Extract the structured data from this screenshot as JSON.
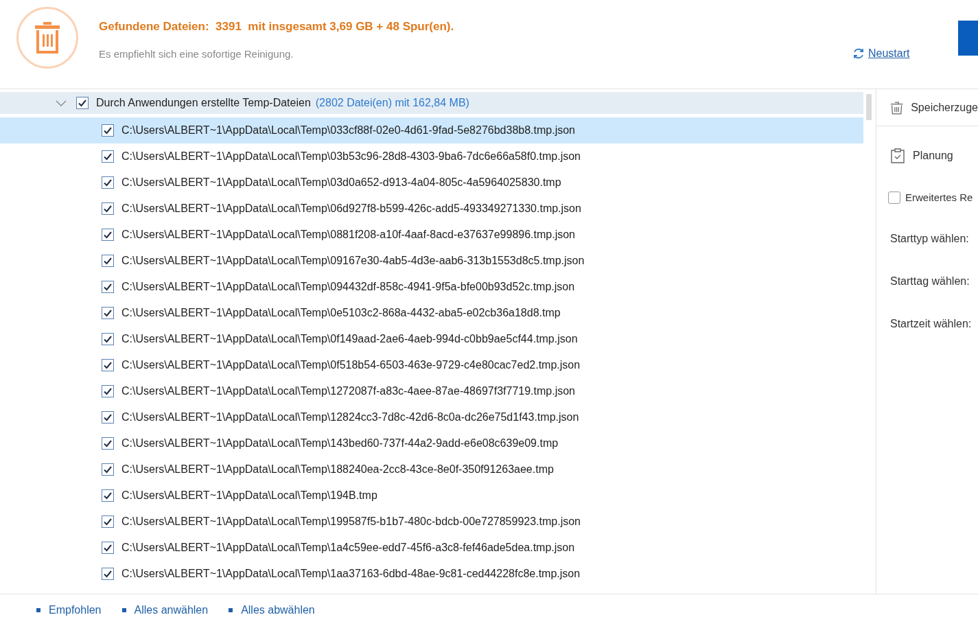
{
  "header": {
    "title": "Gefundene Dateien:  3391  mit insgesamt 3,69 GB + 48 Spur(en).",
    "subtitle": "Es empfiehlt sich eine sofortige Reinigung.",
    "restart_link": "Neustart"
  },
  "group": {
    "label": "Durch Anwendungen erstellte Temp-Dateien",
    "info": "(2802 Datei(en) mit 162,84 MB)",
    "expanded": true,
    "checked": true,
    "files": [
      {
        "path": "C:\\Users\\ALBERT~1\\AppData\\Local\\Temp\\033cf88f-02e0-4d61-9fad-5e8276bd38b8.tmp.json",
        "checked": true,
        "selected": true
      },
      {
        "path": "C:\\Users\\ALBERT~1\\AppData\\Local\\Temp\\03b53c96-28d8-4303-9ba6-7dc6e66a58f0.tmp.json",
        "checked": true,
        "selected": false
      },
      {
        "path": "C:\\Users\\ALBERT~1\\AppData\\Local\\Temp\\03d0a652-d913-4a04-805c-4a5964025830.tmp",
        "checked": true,
        "selected": false
      },
      {
        "path": "C:\\Users\\ALBERT~1\\AppData\\Local\\Temp\\06d927f8-b599-426c-add5-493349271330.tmp.json",
        "checked": true,
        "selected": false
      },
      {
        "path": "C:\\Users\\ALBERT~1\\AppData\\Local\\Temp\\0881f208-a10f-4aaf-8acd-e37637e99896.tmp.json",
        "checked": true,
        "selected": false
      },
      {
        "path": "C:\\Users\\ALBERT~1\\AppData\\Local\\Temp\\09167e30-4ab5-4d3e-aab6-313b1553d8c5.tmp.json",
        "checked": true,
        "selected": false
      },
      {
        "path": "C:\\Users\\ALBERT~1\\AppData\\Local\\Temp\\094432df-858c-4941-9f5a-bfe00b93d52c.tmp.json",
        "checked": true,
        "selected": false
      },
      {
        "path": "C:\\Users\\ALBERT~1\\AppData\\Local\\Temp\\0e5103c2-868a-4432-aba5-e02cb36a18d8.tmp",
        "checked": true,
        "selected": false
      },
      {
        "path": "C:\\Users\\ALBERT~1\\AppData\\Local\\Temp\\0f149aad-2ae6-4aeb-994d-c0bb9ae5cf44.tmp.json",
        "checked": true,
        "selected": false
      },
      {
        "path": "C:\\Users\\ALBERT~1\\AppData\\Local\\Temp\\0f518b54-6503-463e-9729-c4e80cac7ed2.tmp.json",
        "checked": true,
        "selected": false
      },
      {
        "path": "C:\\Users\\ALBERT~1\\AppData\\Local\\Temp\\1272087f-a83c-4aee-87ae-48697f3f7719.tmp.json",
        "checked": true,
        "selected": false
      },
      {
        "path": "C:\\Users\\ALBERT~1\\AppData\\Local\\Temp\\12824cc3-7d8c-42d6-8c0a-dc26e75d1f43.tmp.json",
        "checked": true,
        "selected": false
      },
      {
        "path": "C:\\Users\\ALBERT~1\\AppData\\Local\\Temp\\143bed60-737f-44a2-9add-e6e08c639e09.tmp",
        "checked": true,
        "selected": false
      },
      {
        "path": "C:\\Users\\ALBERT~1\\AppData\\Local\\Temp\\188240ea-2cc8-43ce-8e0f-350f91263aee.tmp",
        "checked": true,
        "selected": false
      },
      {
        "path": "C:\\Users\\ALBERT~1\\AppData\\Local\\Temp\\194B.tmp",
        "checked": true,
        "selected": false
      },
      {
        "path": "C:\\Users\\ALBERT~1\\AppData\\Local\\Temp\\199587f5-b1b7-480c-bdcb-00e727859923.tmp.json",
        "checked": true,
        "selected": false
      },
      {
        "path": "C:\\Users\\ALBERT~1\\AppData\\Local\\Temp\\1a4c59ee-edd7-45f6-a3c8-fef46ade5dea.tmp.json",
        "checked": true,
        "selected": false
      },
      {
        "path": "C:\\Users\\ALBERT~1\\AppData\\Local\\Temp\\1aa37163-6dbd-48ae-9c81-ced44228fc8e.tmp.json",
        "checked": true,
        "selected": false
      }
    ]
  },
  "side_panel": {
    "section": {
      "label": "Speicherzuge"
    },
    "schedule": {
      "title": "Planung",
      "option": {
        "label": "Erweitertes Re",
        "checked": false
      },
      "fields": [
        "Starttyp wählen:",
        "Starttag wählen:",
        "Startzeit wählen:"
      ]
    }
  },
  "footer": {
    "links": [
      "Empfohlen",
      "Alles anwählen",
      "Alles abwählen"
    ]
  }
}
